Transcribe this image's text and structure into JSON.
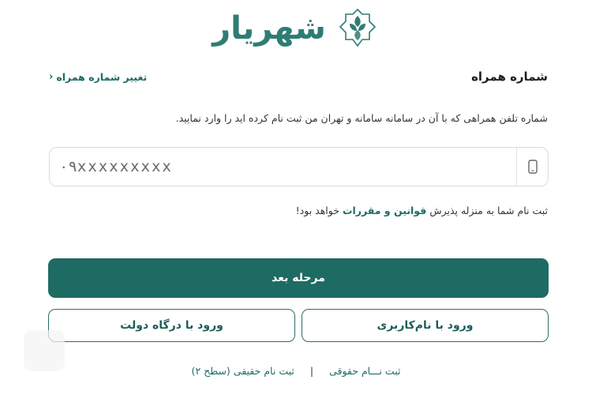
{
  "brand": {
    "logo_text": "شهریار",
    "accent": "#1e6b63",
    "logo_color": "#2e7d74"
  },
  "header": {
    "title": "شماره همراه",
    "change_link": "تغییر شماره همراه"
  },
  "form": {
    "hint": "شماره تلفن همراهی که با آن در سامانه سامانه و تهران من ثبت نام کرده اید را وارد نمایید.",
    "phone_placeholder": "۰۹xxxxxxxxx",
    "phone_icon": "mobile-phone-icon",
    "terms_before": "ثبت نام شما به منزله پذیرش",
    "terms_link": "قوانین و مقررات",
    "terms_after": "خواهد بود!"
  },
  "buttons": {
    "next": "مرحله بعد",
    "login_username": "ورود با نام‌کاربری",
    "login_gov": "ورود با درگاه دولت"
  },
  "footer": {
    "register_legal": "ثبت نـــام حقوقی",
    "separator": "|",
    "register_real": "ثبت نام حقیقی (سطح ۲)"
  }
}
